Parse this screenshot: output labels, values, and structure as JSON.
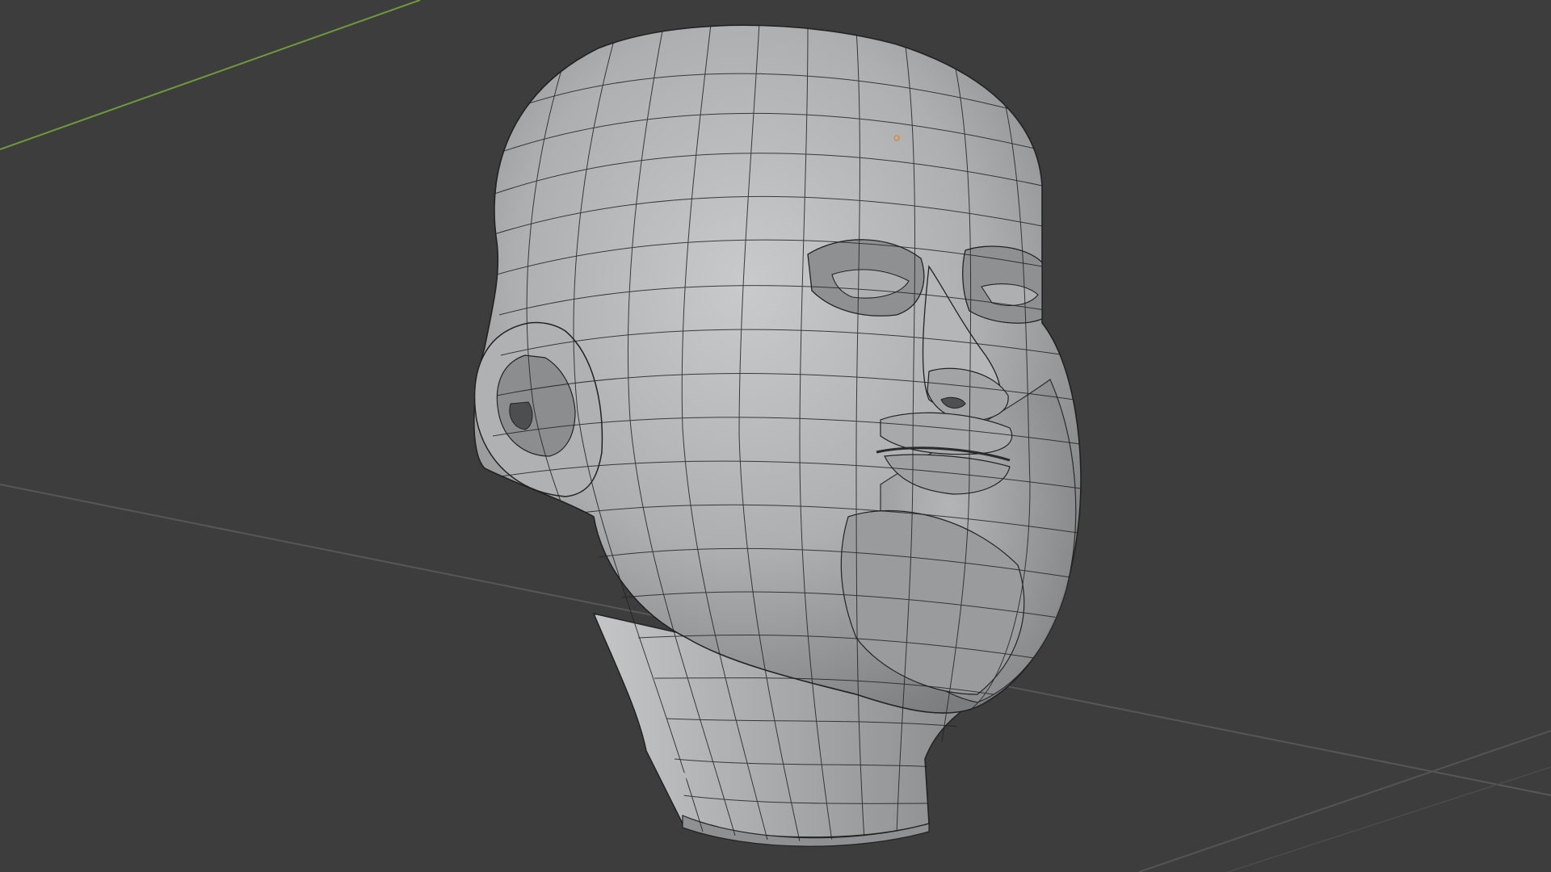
{
  "viewport": {
    "background": "#3d3d3d",
    "grid_line_color": "#575757",
    "y_axis_color": "#6f9a3a",
    "origin_marker_color": "#d98b2b"
  },
  "mesh": {
    "object": "head",
    "shading": "solid",
    "wireframe_overlay": true,
    "base_color": "#a9aaab",
    "light_color": "#c8c9ca",
    "shadow_color": "#6e6f70",
    "edge_color": "#222222"
  }
}
